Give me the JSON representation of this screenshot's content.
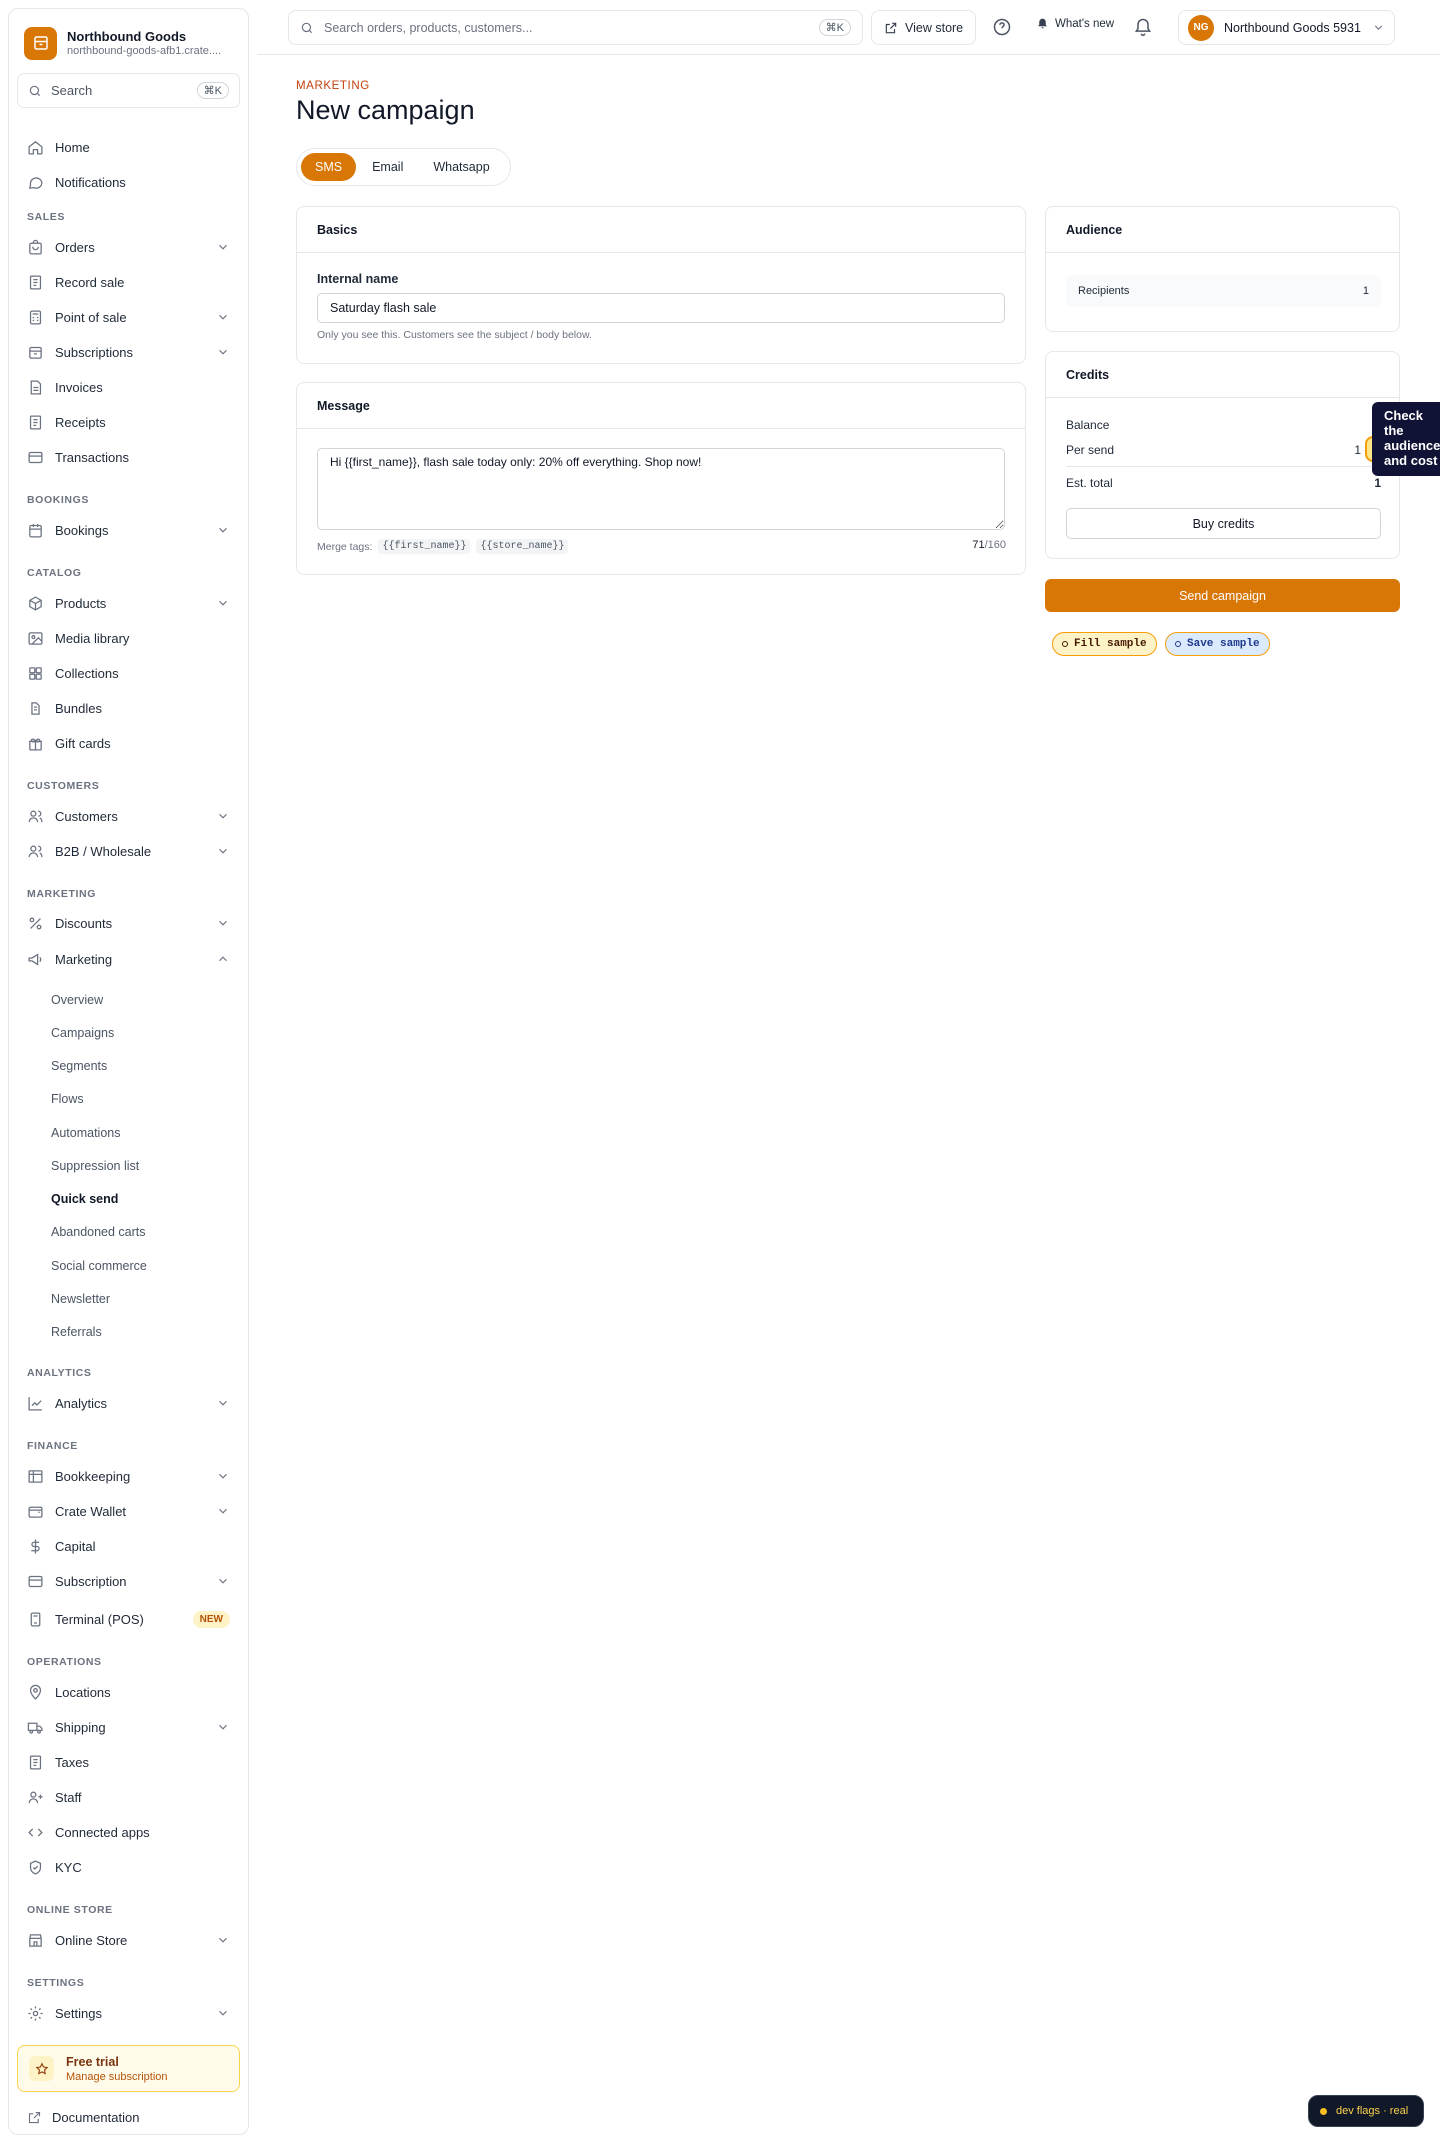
{
  "brand": {
    "name": "Northbound Goods",
    "domain": "northbound-goods-afb1.crate...."
  },
  "sidebar": {
    "search": {
      "label": "Search",
      "shortcut": "⌘K"
    },
    "top_items": [
      {
        "label": "Home",
        "icon": "home-icon"
      },
      {
        "label": "Notifications",
        "icon": "chat-bubble-icon"
      }
    ],
    "sections": {
      "sales": "SALES",
      "bookings": "BOOKINGS",
      "catalog": "CATALOG",
      "customers": "CUSTOMERS",
      "marketing": "MARKETING",
      "analytics": "ANALYTICS",
      "finance": "FINANCE",
      "operations": "OPERATIONS",
      "online_store": "ONLINE STORE",
      "settings": "SETTINGS"
    },
    "items": {
      "orders": "Orders",
      "record_sale": "Record sale",
      "point_of_sale": "Point of sale",
      "subscriptions": "Subscriptions",
      "invoices": "Invoices",
      "receipts": "Receipts",
      "transactions": "Transactions",
      "bookings": "Bookings",
      "products": "Products",
      "media_library": "Media library",
      "collections": "Collections",
      "bundles": "Bundles",
      "gift_cards": "Gift cards",
      "customers": "Customers",
      "b2b": "B2B / Wholesale",
      "discounts": "Discounts",
      "marketing": "Marketing",
      "analytics": "Analytics",
      "bookkeeping": "Bookkeeping",
      "crate_wallet": "Crate Wallet",
      "capital": "Capital",
      "subscription": "Subscription",
      "terminal": "Terminal (POS)",
      "locations": "Locations",
      "shipping": "Shipping",
      "taxes": "Taxes",
      "staff": "Staff",
      "connected_apps": "Connected apps",
      "kyc": "KYC",
      "online_store": "Online Store",
      "settings": "Settings"
    },
    "new_badge": "NEW",
    "marketing_sub": [
      "Overview",
      "Campaigns",
      "Segments",
      "Flows",
      "Automations",
      "Suppression list",
      "Quick send",
      "Abandoned carts",
      "Social commerce",
      "Newsletter",
      "Referrals"
    ],
    "active_sub": "Quick send",
    "trial": {
      "title": "Free trial",
      "subtitle": "Manage subscription"
    },
    "documentation": "Documentation"
  },
  "topbar": {
    "search_placeholder": "Search orders, products, customers...",
    "search_shortcut": "⌘K",
    "view_store": "View store",
    "whats_new": "What's new",
    "account_initials": "NG",
    "account_name": "Northbound Goods 5931"
  },
  "page": {
    "breadcrumb": "MARKETING",
    "title": "New campaign",
    "tabs": [
      "SMS",
      "Email",
      "Whatsapp"
    ],
    "active_tab": "SMS"
  },
  "basics": {
    "title": "Basics",
    "internal_name_label": "Internal name",
    "internal_name_value": "Saturday flash sale",
    "hint": "Only you see this. Customers see the subject / body below."
  },
  "message": {
    "title": "Message",
    "body": "Hi {{first_name}}, flash sale today only: 20% off everything. Shop now!",
    "merge_label": "Merge tags:",
    "merge_tags": [
      "{{first_name}}",
      "{{store_name}}"
    ],
    "char_count": "71",
    "char_limit": "/160"
  },
  "audience": {
    "title": "Audience",
    "recipients_label": "Recipients",
    "recipients_value": "1"
  },
  "credits": {
    "title": "Credits",
    "balance_label": "Balance",
    "balance_value": "",
    "per_send_label": "Per send",
    "per_send_value": "1 cre",
    "est_total_label": "Est. total",
    "est_total_value": "1",
    "buy_label": "Buy credits"
  },
  "actions": {
    "send": "Send campaign",
    "fill_sample": "Fill sample",
    "save_sample": "Save sample"
  },
  "tooltip": {
    "lines": [
      "Check",
      "the",
      "audience",
      "and cost"
    ]
  },
  "dev_flags": "dev flags · real",
  "colors": {
    "accent": "#d97706",
    "tooltip_bg": "#111336"
  }
}
